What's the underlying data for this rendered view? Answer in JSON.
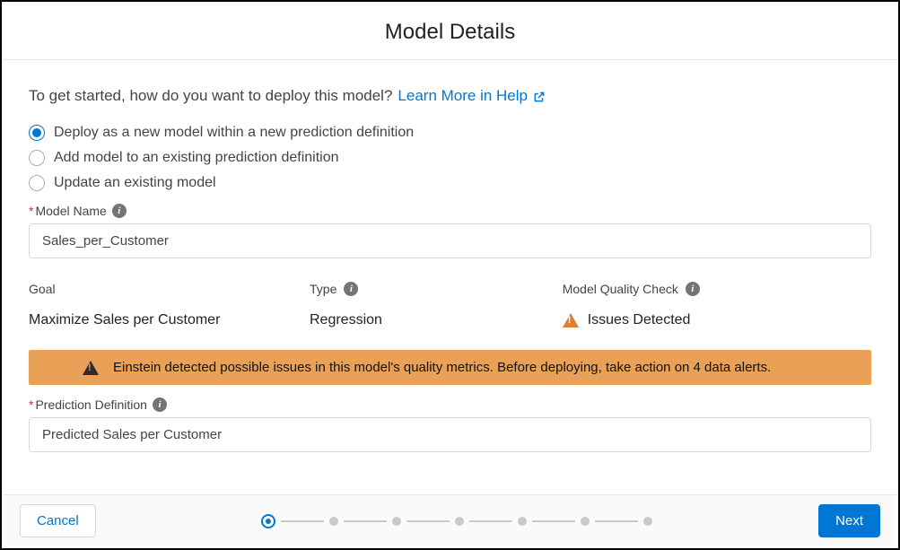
{
  "header": {
    "title": "Model Details"
  },
  "intro": {
    "text": "To get started, how do you want to deploy this model?",
    "help_link": "Learn More in Help"
  },
  "deploy_options": {
    "opt1": "Deploy as a new model within a new prediction definition",
    "opt2": "Add model to an existing prediction definition",
    "opt3": "Update an existing model"
  },
  "model_name": {
    "label": "Model Name",
    "value": "Sales_per_Customer"
  },
  "info": {
    "goal_label": "Goal",
    "goal_value": "Maximize Sales per Customer",
    "type_label": "Type",
    "type_value": "Regression",
    "quality_label": "Model Quality Check",
    "quality_value": "Issues Detected"
  },
  "alert": {
    "message": "Einstein detected possible issues in this model's quality metrics. Before deploying, take action on 4 data alerts."
  },
  "prediction_def": {
    "label": "Prediction Definition",
    "value": "Predicted Sales per Customer"
  },
  "footer": {
    "cancel": "Cancel",
    "next": "Next"
  }
}
